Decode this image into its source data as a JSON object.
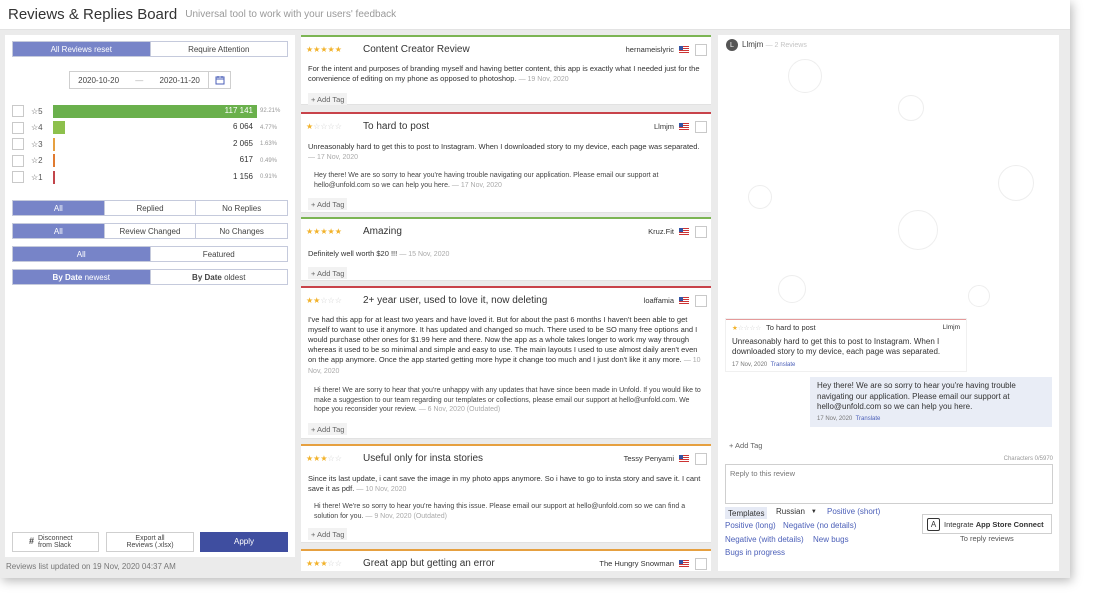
{
  "header": {
    "title": "Reviews & Replies Board",
    "subtitle": "Universal tool to work with your users' feedback"
  },
  "filters": {
    "review_tabs": [
      {
        "label": "All Reviews",
        "suffix": "reset",
        "active": true
      },
      {
        "label": "Require Attention",
        "active": false
      }
    ],
    "date_from": "2020-10-20",
    "date_sep": "—",
    "date_to": "2020-11-20",
    "ratings": [
      {
        "label": "☆5",
        "count": "117 141",
        "pct": "92.21%",
        "fill": 1.0,
        "color": "#6ab04c"
      },
      {
        "label": "☆4",
        "count": "6 064",
        "pct": "4.77%",
        "fill": 0.06,
        "color": "#8dc04c"
      },
      {
        "label": "☆3",
        "count": "2 065",
        "pct": "1.63%",
        "fill": 0.012,
        "color": "#e6a040"
      },
      {
        "label": "☆2",
        "count": "617",
        "pct": "0.49%",
        "fill": 0.008,
        "color": "#e07a30"
      },
      {
        "label": "☆1",
        "count": "1 156",
        "pct": "0.91%",
        "fill": 0.008,
        "color": "#c2454a"
      }
    ],
    "reply_filter": [
      "All",
      "Replied",
      "No Replies"
    ],
    "change_filter": [
      "All",
      "Review Changed",
      "No Changes"
    ],
    "featured_filter": [
      "All",
      "Featured"
    ],
    "sort": [
      {
        "label": "By Date",
        "suffix": "newest"
      },
      {
        "label": "By Date",
        "suffix": "oldest"
      }
    ],
    "disconnect_label": "Disconnect from Slack",
    "export_label": "Export all Reviews (.xlsx)",
    "apply_label": "Apply",
    "updated_text": "Reviews list updated on 19 Nov, 2020 04:37 AM"
  },
  "reviews": [
    {
      "stars": 5,
      "title": "Content Creator Review",
      "author": "hernameislyric",
      "border": "#7cb554",
      "text": "For the intent and purposes of branding myself and having better content, this app is exactly what I needed just for the convenience of editing on my phone as opposed to photoshop.",
      "date": "— 19 Nov, 2020",
      "add_tag": "+ Add Tag"
    },
    {
      "stars": 1,
      "title": "To hard to post",
      "author": "Llmjm",
      "border": "#c8434a",
      "text": "Unreasonably hard to get this to post to Instagram. When I downloaded story to my device, each page was separated.",
      "date": "— 17 Nov, 2020",
      "reply": "Hey there! We are so sorry to hear you're having trouble navigating our application. Please email our support at hello@unfold.com so we can help you here.",
      "reply_date": "— 17 Nov, 2020",
      "add_tag": "+ Add Tag"
    },
    {
      "stars": 5,
      "title": "Amazing",
      "author": "Kruz.Fit",
      "border": "#7cb554",
      "text": "Definitely well worth $20 !!!",
      "date": "— 15 Nov, 2020",
      "add_tag": "+ Add Tag"
    },
    {
      "stars": 2,
      "title": "2+ year user, used to love it, now deleting",
      "author": "loaffamia",
      "border": "#c8434a",
      "text": "I've had this app for at least two years and have loved it. But for about the past 6 months I haven't been able to get myself to want to use it anymore. It has updated and changed so much. There used to be SO many free options and I would purchase other ones for $1.99 here and there. Now the app as a whole takes longer to work my way through whereas it used to be so minimal and simple and easy to use. The main layouts I used to use almost daily aren't even on the app anymore. Once the app started getting more hype it change too much and I just don't like it any more.",
      "date": "— 10 Nov, 2020",
      "reply": "Hi there! We are sorry to hear that you're unhappy with any updates that have since been made in Unfold. If you would like to make a suggestion to our team regarding our templates or collections, please email our support at hello@unfold.com. We hope you reconsider your review.",
      "reply_date": "— 6 Nov, 2020 (Outdated)",
      "add_tag": "+ Add Tag"
    },
    {
      "stars": 3,
      "title": "Useful only for insta stories",
      "author": "Tessy Penyami",
      "border": "#e6a040",
      "text": "Since its last update, i cant save the image in my photo apps anymore. So i have to go to insta story and save it. I cant save it as pdf.",
      "date": "— 10 Nov, 2020",
      "reply": "Hi there! We're so sorry to hear you're having this issue. Please email our support at hello@unfold.com so we can find a solution for you.",
      "reply_date": "— 9 Nov, 2020 (Outdated)",
      "add_tag": "+ Add Tag"
    },
    {
      "stars": 3,
      "title": "Great app but getting an error",
      "author": "The Hungry Snowman",
      "border": "#e6a040"
    }
  ],
  "detail": {
    "avatar_letter": "L",
    "user": "Llmjm",
    "count": "— 2 Reviews",
    "review_title": "To hard to post",
    "review_author": "Llmjm",
    "review_text": "Unreasonably hard to get this to post to Instagram. When I downloaded story to my device, each page was separated.",
    "review_date": "17 Nov, 2020",
    "translate": "Translate",
    "reply_text": "Hey there! We are so sorry to hear you're having trouble navigating our application. Please email our support at hello@unfold.com so we can help you here.",
    "reply_date": "17 Nov, 2020",
    "add_tag": "+ Add Tag",
    "characters": "Characters 0/5970",
    "reply_placeholder": "Reply to this review",
    "templates_label": "Templates",
    "language": "Russian",
    "template_links": [
      "Positive (short)",
      "Positive (long)",
      "Negative (no details)",
      "Negative (with details)",
      "New bugs",
      "Bugs in progress"
    ],
    "integrate_prefix": "Integrate",
    "integrate_name": "App Store Connect",
    "integrate_sub": "To reply reviews"
  }
}
